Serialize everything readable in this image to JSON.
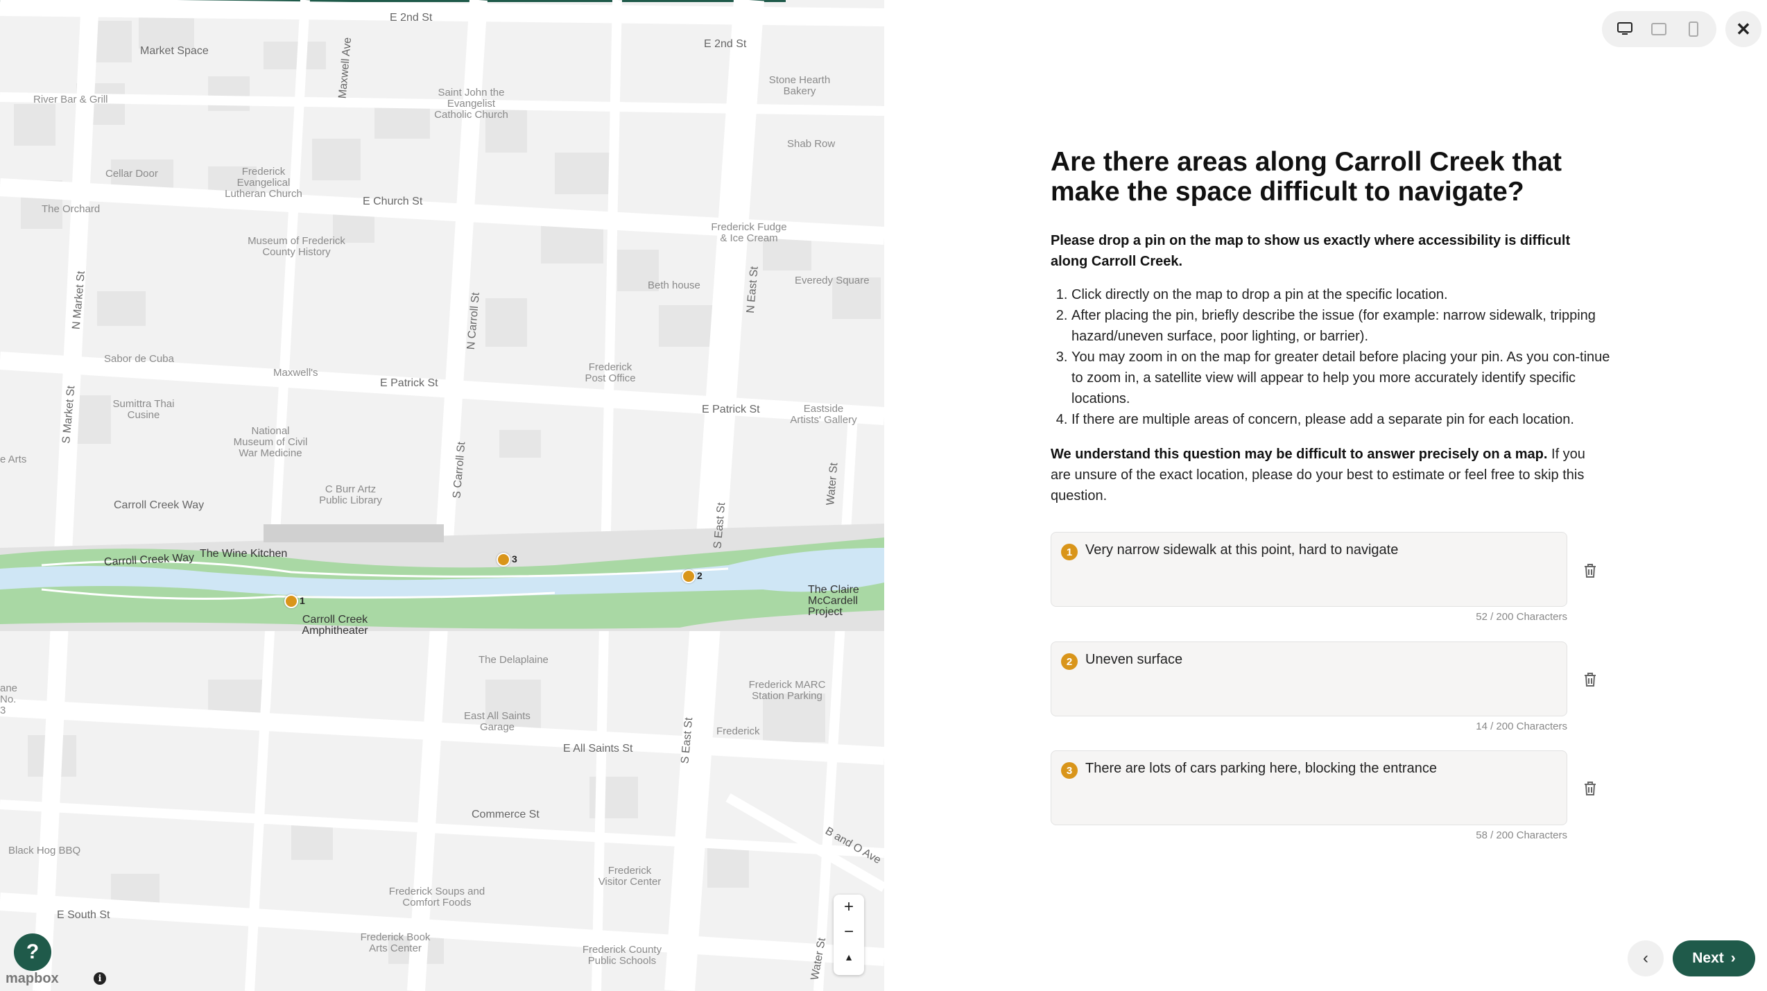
{
  "map": {
    "streets": [
      "E 2nd St",
      "E 2nd St",
      "Market Space",
      "Maxwell Ave",
      "E Church St",
      "N Market St",
      "N Carroll St",
      "N East St",
      "E Patrick St",
      "E Patrick St",
      "S Market St",
      "S Carroll St",
      "Water St",
      "S East St",
      "Carroll Creek Way",
      "Carroll Creek Way",
      "E All Saints St",
      "Commerce St",
      "B and O Ave",
      "E South St",
      "S East St",
      "Water St"
    ],
    "places": [
      "River Bar & Grill",
      "Saint John the Evangelist Catholic Church",
      "Stone Hearth Bakery",
      "Shab Row",
      "Cellar Door",
      "Frederick Evangelical Lutheran Church",
      "The Orchard",
      "Museum of Frederick County History",
      "Frederick Fudge & Ice Cream",
      "Everedy Square",
      "Beth house",
      "Sabor de Cuba",
      "Maxwell's",
      "Frederick Post Office",
      "Sumittra Thai Cusine",
      "National Museum of Civil War Medicine",
      "C Burr Artz Public Library",
      "Eastside Artists' Gallery",
      "e Arts",
      "The Wine Kitchen",
      "Carroll Creek Amphitheater",
      "The Claire McCardell Project",
      "The Delaplaine",
      "Frederick MARC Station Parking",
      "East All Saints Garage",
      "Frederick",
      "Black Hog BBQ",
      "Frederick Visitor Center",
      "Frederick Soups and Comfort Foods",
      "Frederick Book Arts Center",
      "Frederick County Public Schools",
      "ane No. 3"
    ],
    "pins": [
      "1",
      "2",
      "3"
    ],
    "zoom_in": "+",
    "zoom_out": "−",
    "compass": "▲",
    "help": "?",
    "attribution": "mapbox",
    "info": "i",
    "colors": {
      "creek": "#cfe6f5",
      "park": "#a9d8a4",
      "pin": "#d9951a",
      "accent": "#1f5a4a"
    }
  },
  "header": {
    "close": "✕",
    "devices": [
      "desktop-icon",
      "tablet-icon",
      "mobile-icon"
    ]
  },
  "question": {
    "title": "Are there areas along Carroll Creek that make the space difficult to navigate?",
    "lead": "Please drop a pin on the map to show us exactly where accessibility is difficult along Carroll Creek.",
    "steps": [
      "Click directly on the map to drop a pin at the specific location.",
      "After placing the pin, briefly describe the issue (for example: narrow sidewalk, tripping hazard/uneven surface, poor lighting, or barrier).",
      "You may zoom in on the map for greater detail before placing your pin. As you con-tinue to zoom in, a satellite view will appear to help you more accurately identify specific locations.",
      "If there are multiple areas of concern, please add a separate pin for each location."
    ],
    "note_bold": "We understand this question may be difficult to answer precisely on a map.",
    "note_rest": " If you are unsure of the exact location, please do your best to estimate or feel free to skip this question."
  },
  "answers": [
    {
      "num": "1",
      "text": "Very narrow sidewalk at this point, hard to navigate",
      "count": "52 / 200 Characters"
    },
    {
      "num": "2",
      "text": "Uneven surface",
      "count": "14 / 200 Characters"
    },
    {
      "num": "3",
      "text": "There are lots of cars parking here, blocking the entrance",
      "count": "58 / 200 Characters"
    }
  ],
  "nav": {
    "prev": "‹",
    "next": "Next",
    "next_arrow": "›"
  }
}
